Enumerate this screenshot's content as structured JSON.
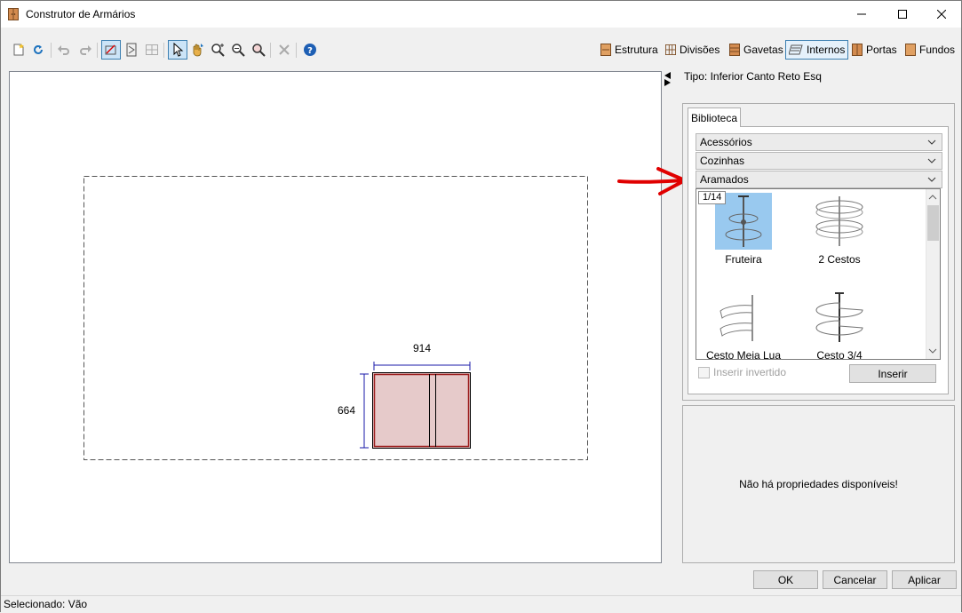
{
  "window": {
    "title": "Construtor de Armários",
    "controls": {
      "minimize": "—",
      "maximize": "☐",
      "close": "✕"
    }
  },
  "toolbar": {
    "icons": [
      "new-icon",
      "refresh-icon",
      "undo-icon",
      "redo-icon",
      "shape-icon",
      "door-icon",
      "grid-icon",
      "pointer-icon",
      "pan-icon",
      "zoom-in-icon",
      "zoom-out-icon",
      "zoom-fit-icon",
      "delete-icon",
      "help-icon"
    ],
    "modes": [
      {
        "label": "Estrutura",
        "active": false
      },
      {
        "label": "Divisões",
        "active": false
      },
      {
        "label": "Gavetas",
        "active": false
      },
      {
        "label": "Internos",
        "active": true
      },
      {
        "label": "Portas",
        "active": false
      },
      {
        "label": "Fundos",
        "active": false
      }
    ]
  },
  "drawing": {
    "width_label": "914",
    "height_label": "664"
  },
  "panel": {
    "tipo": "Tipo: Inferior Canto Reto Esq",
    "library_tab": "Biblioteca",
    "categories": [
      "Acessórios",
      "Cozinhas",
      "Aramados"
    ],
    "page_indicator": "1/14",
    "items": [
      {
        "label": "Fruteira",
        "selected": true
      },
      {
        "label": "2 Cestos",
        "selected": false
      },
      {
        "label": "Cesto Meia Lua",
        "selected": false
      },
      {
        "label": "Cesto 3/4",
        "selected": false
      }
    ],
    "insert_inverted_label": "Inserir invertido",
    "insert_button": "Inserir",
    "no_properties": "Não há propriedades disponíveis!"
  },
  "buttons": {
    "ok": "OK",
    "cancel": "Cancelar",
    "apply": "Aplicar"
  },
  "status": {
    "text": "Selecionado: Vão"
  },
  "colors": {
    "accent": "#3c7fb1",
    "annotation": "#1a1aaa",
    "cabinet_fill": "#e6caca",
    "cabinet_border": "#9b1b1b",
    "arrow": "#e00000"
  }
}
